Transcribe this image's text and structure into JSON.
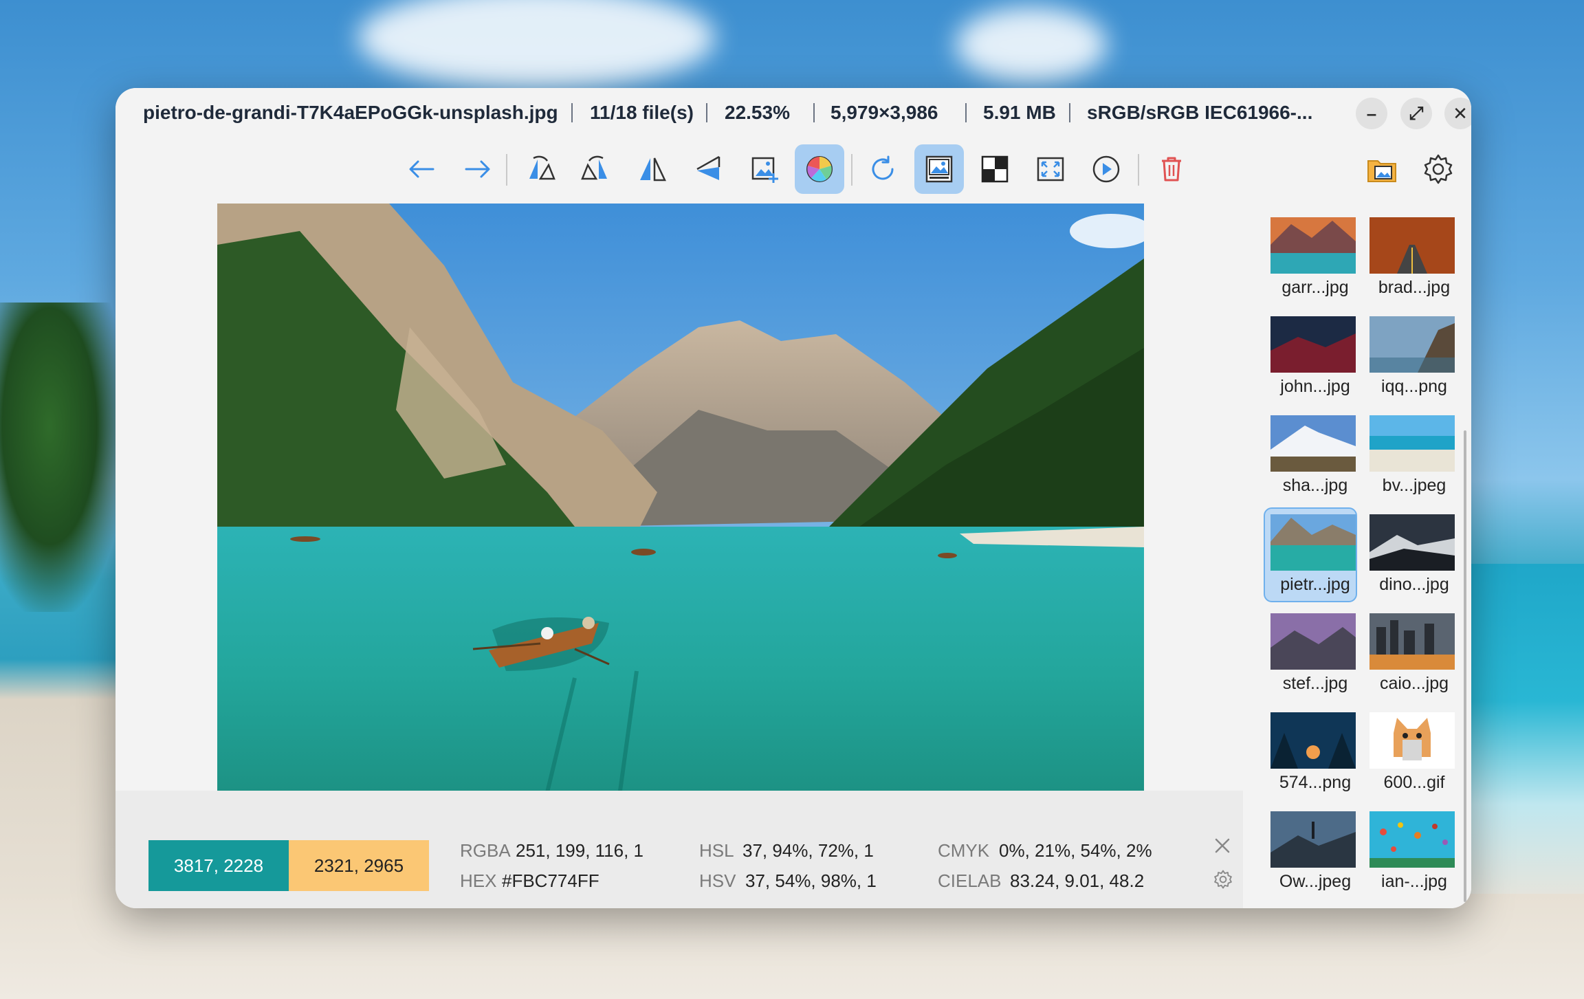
{
  "window": {
    "file_name": "pietro-de-grandi-T7K4aEPoGGk-unsplash.jpg",
    "file_index": "11/18 file(s)",
    "zoom": "22.53%",
    "dimensions": "5,979×3,986",
    "file_size": "5.91 MB",
    "color_profile": "sRGB/sRGB IEC61966-...",
    "controls": {
      "minimize": "–",
      "maximize": "⤢",
      "close": "✕"
    }
  },
  "toolbar": {
    "tools": [
      "previous-arrow-icon",
      "next-arrow-icon",
      "rotate-left-flip-icon",
      "rotate-right-flip-icon",
      "flip-horizontal-icon",
      "flip-vertical-icon",
      "crop-icon",
      "color-picker-icon",
      "refresh-icon",
      "gallery-icon",
      "checkerboard-icon",
      "fit-screen-icon",
      "play-icon",
      "trash-icon",
      "open-folder-icon",
      "settings-gear-icon"
    ],
    "active_tools": [
      "color-picker-icon",
      "gallery-icon"
    ],
    "accent": "#3a8ee6",
    "delete_color": "#e05252"
  },
  "color_info": {
    "coord1": "3817, 2228",
    "coord1_color": "#15999a",
    "coord2": "2321, 2965",
    "coord2_color": "#fbc774",
    "rgba_label": "RGBA",
    "rgba_value": "251, 199, 116, 1",
    "hex_label": "HEX",
    "hex_value": "#FBC774FF",
    "hsl_label": "HSL",
    "hsl_value": "37, 94%, 72%, 1",
    "hsv_label": "HSV",
    "hsv_value": "37, 54%, 98%, 1",
    "cmyk_label": "CMYK",
    "cmyk_value": "0%, 21%, 54%, 2%",
    "cielab_label": "CIELAB",
    "cielab_value": "83.24, 9.01, 48.2"
  },
  "thumbnails": [
    {
      "label": "garr...jpg"
    },
    {
      "label": "brad...jpg"
    },
    {
      "label": "john...jpg"
    },
    {
      "label": "iqq...png"
    },
    {
      "label": "sha...jpg"
    },
    {
      "label": "bv...jpeg"
    },
    {
      "label": "pietr...jpg",
      "selected": true
    },
    {
      "label": "dino...jpg"
    },
    {
      "label": "stef...jpg"
    },
    {
      "label": "caio...jpg"
    },
    {
      "label": "574...png"
    },
    {
      "label": "600...gif"
    },
    {
      "label": "Ow...jpeg"
    },
    {
      "label": "ian-...jpg"
    }
  ]
}
